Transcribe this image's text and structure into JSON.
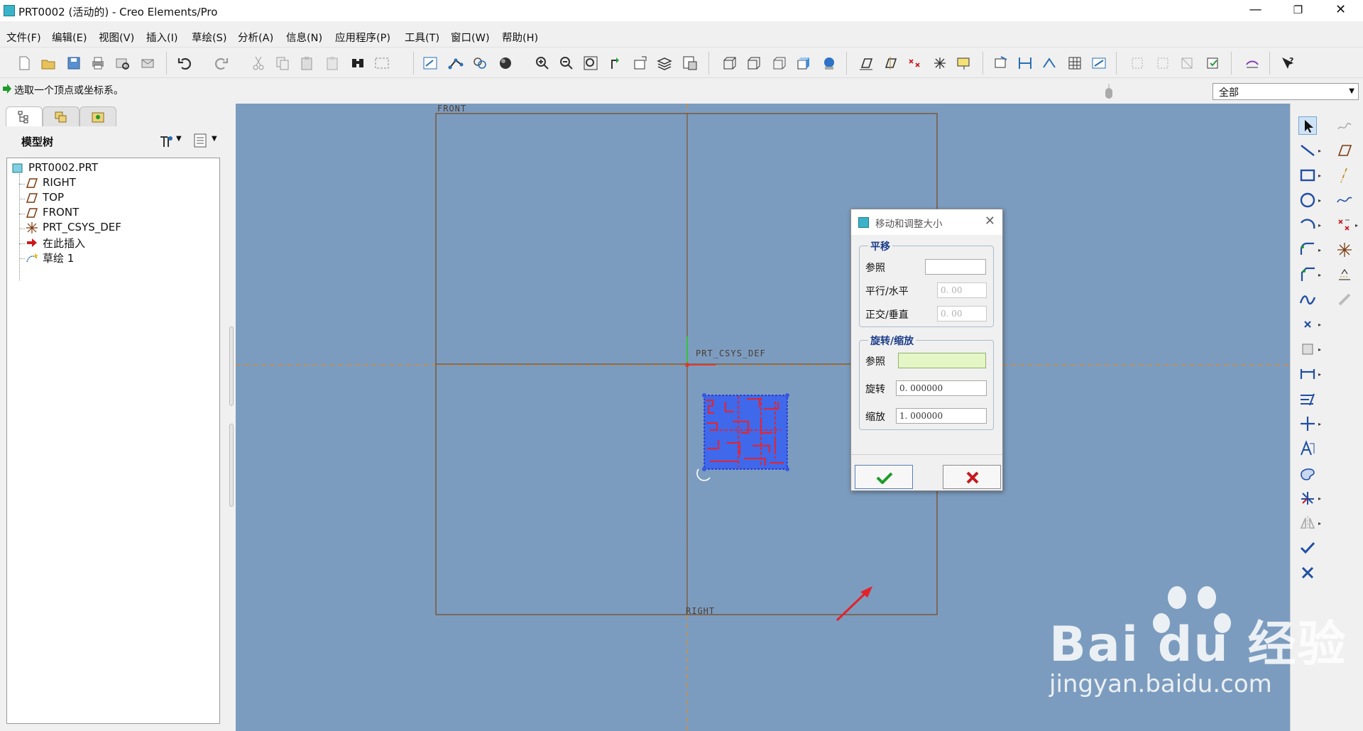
{
  "window": {
    "title": "PRT0002 (活动的) - Creo Elements/Pro",
    "controls": {
      "minimize": "—",
      "maximize": "❐",
      "close": "✕"
    }
  },
  "menu": [
    "文件(F)",
    "编辑(E)",
    "视图(V)",
    "插入(I)",
    "草绘(S)",
    "分析(A)",
    "信息(N)",
    "应用程序(P)",
    "工具(T)",
    "窗口(W)",
    "帮助(H)"
  ],
  "status": {
    "message": "选取一个顶点或坐标系。",
    "filter_value": "全部"
  },
  "left_panel": {
    "header_title": "模型树",
    "tree": [
      {
        "label": "PRT0002.PRT",
        "icon": "part-icon"
      },
      {
        "label": "RIGHT",
        "icon": "datum-plane-icon"
      },
      {
        "label": "TOP",
        "icon": "datum-plane-icon"
      },
      {
        "label": "FRONT",
        "icon": "datum-plane-icon"
      },
      {
        "label": "PRT_CSYS_DEF",
        "icon": "csys-icon"
      },
      {
        "label": "在此插入",
        "icon": "insert-here-icon"
      },
      {
        "label": "草绘 1",
        "icon": "sketch-icon"
      }
    ]
  },
  "canvas": {
    "labels": {
      "front": "FRONT",
      "right": "RIGHT",
      "csys": "PRT_CSYS_DEF"
    }
  },
  "dialog": {
    "title": "移动和调整大小",
    "translate": {
      "group": "平移",
      "ref_label": "参照",
      "ref_value": "",
      "parallel_label": "平行/水平",
      "parallel_value": "0. 00",
      "normal_label": "正交/垂直",
      "normal_value": "0. 00"
    },
    "rotate_scale": {
      "group": "旋转/缩放",
      "ref_label": "参照",
      "ref_value": "",
      "rotate_label": "旋转",
      "rotate_value": "0. 000000",
      "scale_label": "缩放",
      "scale_value": "1. 000000"
    }
  },
  "watermark": {
    "brand": "Bai du 经验",
    "url": "jingyan.baidu.com"
  },
  "colors": {
    "canvas": "#7c9cbf",
    "accent_green": "#1c9b2a",
    "accent_red": "#c8171d"
  }
}
